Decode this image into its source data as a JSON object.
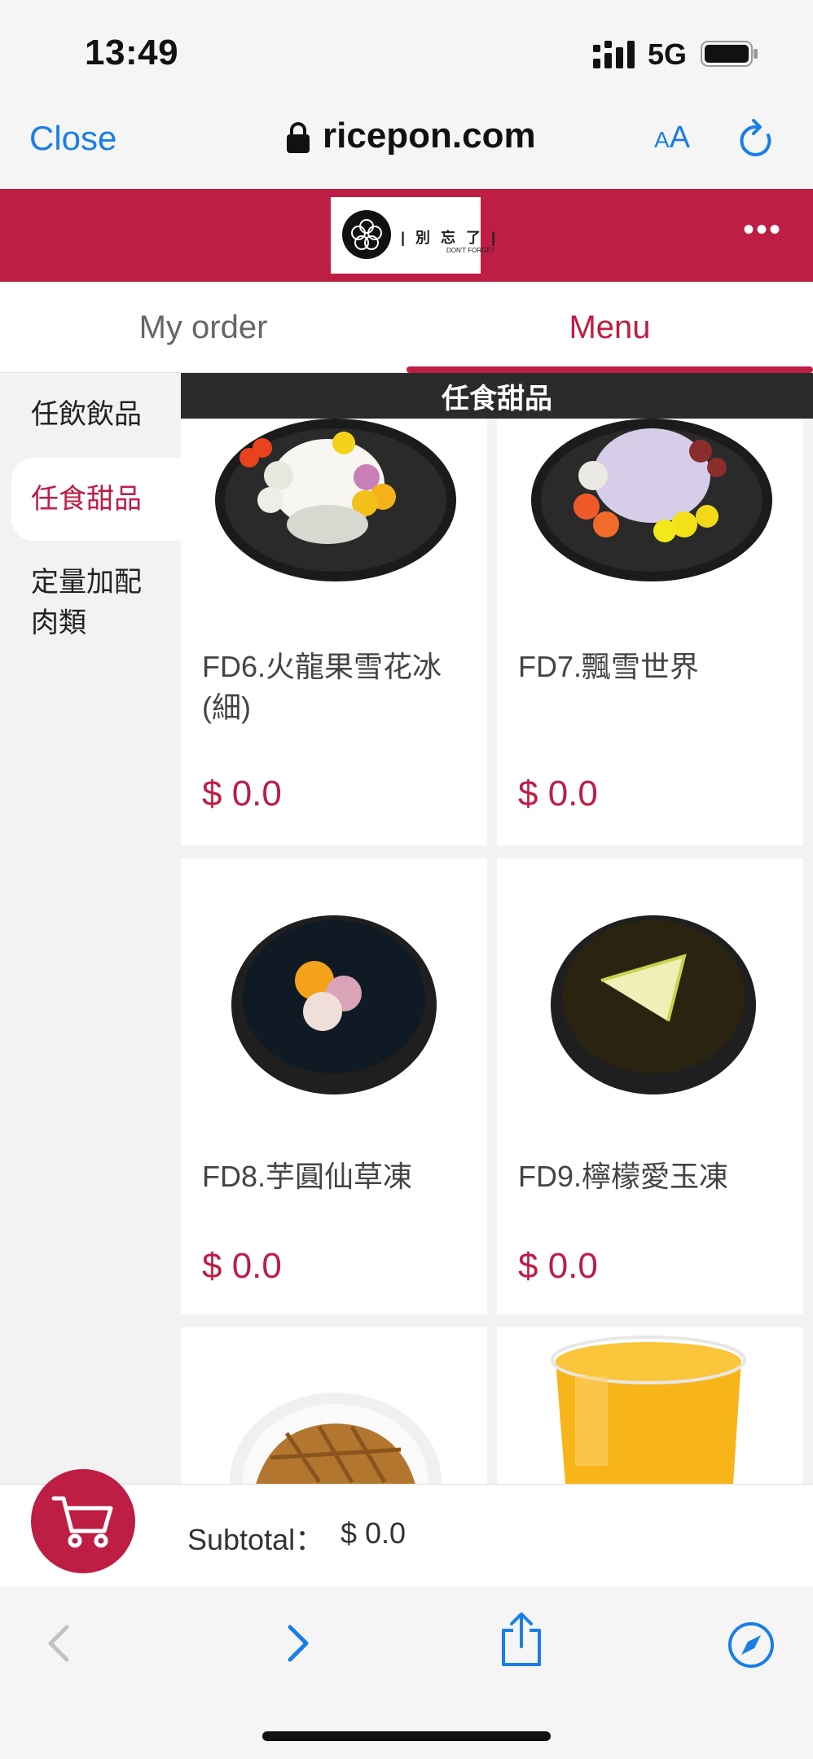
{
  "status_bar": {
    "time": "13:49",
    "network": "5G"
  },
  "browser": {
    "close_label": "Close",
    "url": "ricepon.com",
    "text_size_small": "A",
    "text_size_large": "A"
  },
  "site": {
    "logo_text": "| 別 忘 了 |",
    "logo_sub": "DON'T FORGET",
    "brand_color": "#be1d44"
  },
  "tabs": [
    {
      "label": "My order"
    },
    {
      "label": "Menu"
    }
  ],
  "sidebar": {
    "items": [
      {
        "label": "任飲飲品"
      },
      {
        "label": "任食甜品"
      },
      {
        "label": "定量加配肉類"
      }
    ]
  },
  "section": {
    "title": "任食甜品"
  },
  "products": [
    {
      "name": "FD6.火龍果雪花冰(細)",
      "price": "$ 0.0"
    },
    {
      "name": "FD7.飄雪世界",
      "price": "$ 0.0"
    },
    {
      "name": "FD8.芋圓仙草凍",
      "price": "$ 0.0"
    },
    {
      "name": "FD9.檸檬愛玉凍",
      "price": "$ 0.0"
    }
  ],
  "cart": {
    "subtotal_label": "Subtotal：",
    "subtotal_value": "$ 0.0"
  }
}
